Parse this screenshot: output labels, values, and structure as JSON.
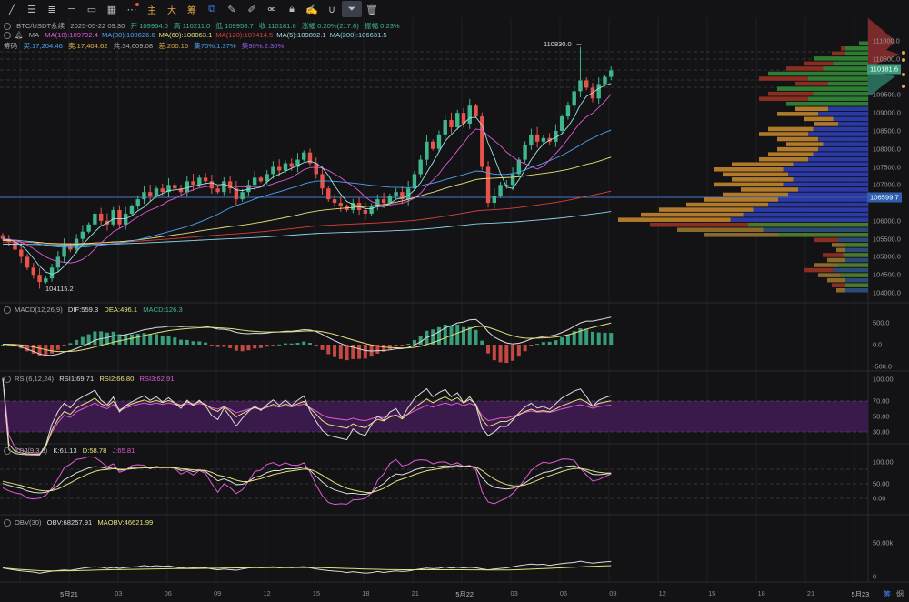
{
  "toolbar": {
    "items": [
      {
        "name": "trend-line-icon",
        "glyph": "╱"
      },
      {
        "name": "parallel-lines-icon",
        "glyph": "☰"
      },
      {
        "name": "fib-icon",
        "glyph": "≣"
      },
      {
        "name": "horizontal-line-icon",
        "glyph": "─"
      },
      {
        "name": "rectangle-icon",
        "glyph": "▭"
      },
      {
        "name": "grid-icon",
        "glyph": "▦"
      },
      {
        "name": "more-icon",
        "glyph": "⋯"
      }
    ],
    "cn_buttons": [
      "主",
      "大",
      "筹"
    ],
    "tools": [
      {
        "name": "select-icon",
        "glyph": "⧉"
      },
      {
        "name": "ruler-icon",
        "glyph": "✎"
      },
      {
        "name": "pen-icon",
        "glyph": "✐"
      },
      {
        "name": "link-icon",
        "glyph": "⚮"
      },
      {
        "name": "lock-icon",
        "glyph": "🔒︎"
      },
      {
        "name": "edit-icon",
        "glyph": "✍"
      },
      {
        "name": "magnet-icon",
        "glyph": "∪"
      },
      {
        "name": "filter-icon",
        "glyph": "⏷"
      },
      {
        "name": "trash-icon",
        "glyph": "🗑︎"
      }
    ]
  },
  "header": {
    "symbol": "BTC/USDT永续",
    "datetime": "2025-05-22 09:30",
    "open": "开 109964.0",
    "high": "高 110211.0",
    "low": "低 109958.7",
    "close": "收 110181.6",
    "change": "涨幅 0.20%(217.6)",
    "amplitude": "振幅 0.23%"
  },
  "ma": {
    "label": "MA",
    "items": [
      {
        "text": "MA(10):109792.4",
        "color": "#e05ad6"
      },
      {
        "text": "MA(30):108626.6",
        "color": "#4aa3f0"
      },
      {
        "text": "MA(60):108063.1",
        "color": "#e6e07a"
      },
      {
        "text": "MA(120):107414.5",
        "color": "#d9403a"
      },
      {
        "text": "MA(5):109892.1",
        "color": "#9fe0e0"
      },
      {
        "text": "MA(200):106631.5",
        "color": "#8fd6e8"
      }
    ]
  },
  "chips": {
    "label": "筹码",
    "buy": "买:17,204.46",
    "sell": "卖:17,404.62",
    "total": "共:34,609.08",
    "diff": "差:200.16",
    "c70": "集70%:1.37%",
    "c90": "集90%:2.30%"
  },
  "annotations": {
    "high": "110830.0",
    "low": "104115.2"
  },
  "price_axis": [
    "111000.0",
    "110500.0",
    "109500.0",
    "109000.0",
    "108500.0",
    "108000.0",
    "107500.0",
    "107000.0",
    "106000.0",
    "105500.0",
    "105000.0",
    "104500.0",
    "104000.0"
  ],
  "price_axis_values": [
    111000,
    110500,
    109500,
    109000,
    108500,
    108000,
    107500,
    107000,
    106000,
    105500,
    105000,
    104500,
    104000
  ],
  "current_price": "110181.6",
  "marker_price": "106599.7",
  "macd": {
    "label": "MACD(12,26,9)",
    "dif": "DIF:559.3",
    "dea": "DEA:496.1",
    "macd": "MACD:126.3",
    "axis": [
      "500.0",
      "0.0",
      "-500.0"
    ]
  },
  "rsi": {
    "label": "RSI(6,12,24)",
    "rsi1": "RSI1:69.71",
    "rsi2": "RSI2:66.80",
    "rsi3": "RSI3:62.91",
    "axis": [
      "100.00",
      "70.00",
      "50.00",
      "30.00"
    ]
  },
  "kdj": {
    "label": "KDJ(9,3,3)",
    "k": "K:61.13",
    "d": "D:58.78",
    "j": "J:65.81",
    "axis": [
      "100.00",
      "50.00",
      "0.00"
    ]
  },
  "obv": {
    "label": "OBV(30)",
    "obv": "OBV:68257.91",
    "maobv": "MAOBV:46621.99",
    "axis": [
      "50.00k",
      "0"
    ]
  },
  "time_axis": [
    "5月21",
    "03",
    "06",
    "09",
    "12",
    "15",
    "18",
    "21",
    "5月22",
    "03",
    "06",
    "09",
    "12",
    "15",
    "18",
    "21",
    "5月23"
  ],
  "corner_buttons": [
    "筹",
    "烟"
  ],
  "colors": {
    "up": "#3fb68b",
    "down": "#e5534b",
    "bg": "#131316",
    "accent": "#3b82f6"
  },
  "chart_data": {
    "type": "candlestick",
    "title": "BTC/USDT永续",
    "ylim": [
      104000,
      111000
    ],
    "closes": [
      105500,
      105400,
      105200,
      105000,
      104700,
      104500,
      104300,
      104400,
      104700,
      105000,
      105300,
      105200,
      105500,
      105700,
      105900,
      106200,
      106000,
      105900,
      106300,
      105900,
      106200,
      106400,
      106600,
      106800,
      106700,
      106900,
      106800,
      107000,
      106900,
      106800,
      107100,
      107000,
      107200,
      107100,
      106900,
      106800,
      107100,
      106900,
      106600,
      106800,
      107000,
      107200,
      107100,
      107300,
      107500,
      107400,
      107600,
      107500,
      107700,
      107900,
      107600,
      107300,
      106900,
      106600,
      106500,
      106400,
      106300,
      106500,
      106300,
      106200,
      106400,
      106600,
      106500,
      106700,
      106800,
      106600,
      106900,
      107300,
      107700,
      108200,
      108000,
      108400,
      108800,
      108600,
      109000,
      108700,
      109200,
      108900,
      107500,
      106500,
      106700,
      107000,
      107000,
      107300,
      107700,
      108100,
      108400,
      108200,
      108300,
      108200,
      108500,
      108900,
      109200,
      109600,
      109900,
      109700,
      109400,
      109800,
      110000,
      110181.6
    ],
    "extreme_high": {
      "index": 94,
      "value": 110830.0
    },
    "extreme_low": {
      "index": 6,
      "value": 104115.2
    },
    "volume_profile": {
      "price_range": [
        104000,
        111000
      ],
      "values": [
        10,
        30,
        40,
        60,
        70,
        90,
        110,
        120,
        80,
        100,
        110,
        120,
        90,
        80,
        100,
        70,
        60,
        110,
        120,
        100,
        90,
        100,
        110,
        120,
        150,
        170,
        160,
        150,
        170,
        140,
        160,
        180,
        200,
        230,
        250,
        275,
        240,
        210,
        180,
        60,
        40,
        35,
        50,
        45,
        60,
        70,
        55,
        45,
        40,
        35
      ]
    }
  }
}
